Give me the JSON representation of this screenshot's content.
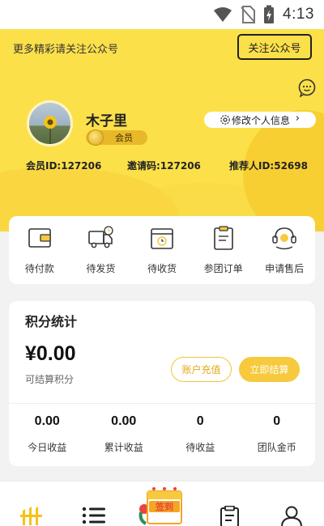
{
  "status_bar": {
    "time": "4:13"
  },
  "header": {
    "promo_text": "更多精彩请关注公众号",
    "follow_button": "关注公众号",
    "username": "木子里",
    "member_level": "会员",
    "edit_profile": "修改个人信息",
    "member_id": "会员ID:127206",
    "invite_code": "邀请码:127206",
    "referrer_id": "推荐人ID:52698"
  },
  "orders": [
    {
      "label": "待付款",
      "icon": "wallet-icon"
    },
    {
      "label": "待发货",
      "icon": "delivery-truck-icon"
    },
    {
      "label": "待收货",
      "icon": "package-box-icon"
    },
    {
      "label": "参团订单",
      "icon": "clipboard-order-icon"
    },
    {
      "label": "申请售后",
      "icon": "customer-service-icon"
    }
  ],
  "points": {
    "title": "积分统计",
    "amount": "¥0.00",
    "amount_label": "可结算积分",
    "recharge_button": "账户充值",
    "settle_button": "立即结算",
    "stats": [
      {
        "value": "0.00",
        "label": "今日收益"
      },
      {
        "value": "0.00",
        "label": "累计收益"
      },
      {
        "value": "0",
        "label": "待收益"
      },
      {
        "value": "0",
        "label": "团队金币"
      }
    ]
  },
  "nav": {
    "signin_badge": "签到",
    "icons": [
      "home-icon",
      "list-icon",
      "signin-icon",
      "orders-icon",
      "profile-icon"
    ]
  },
  "colors": {
    "header_yellow": "#fbe04a",
    "accent_gold": "#f7c93c",
    "nav_active": "#f5c218"
  }
}
